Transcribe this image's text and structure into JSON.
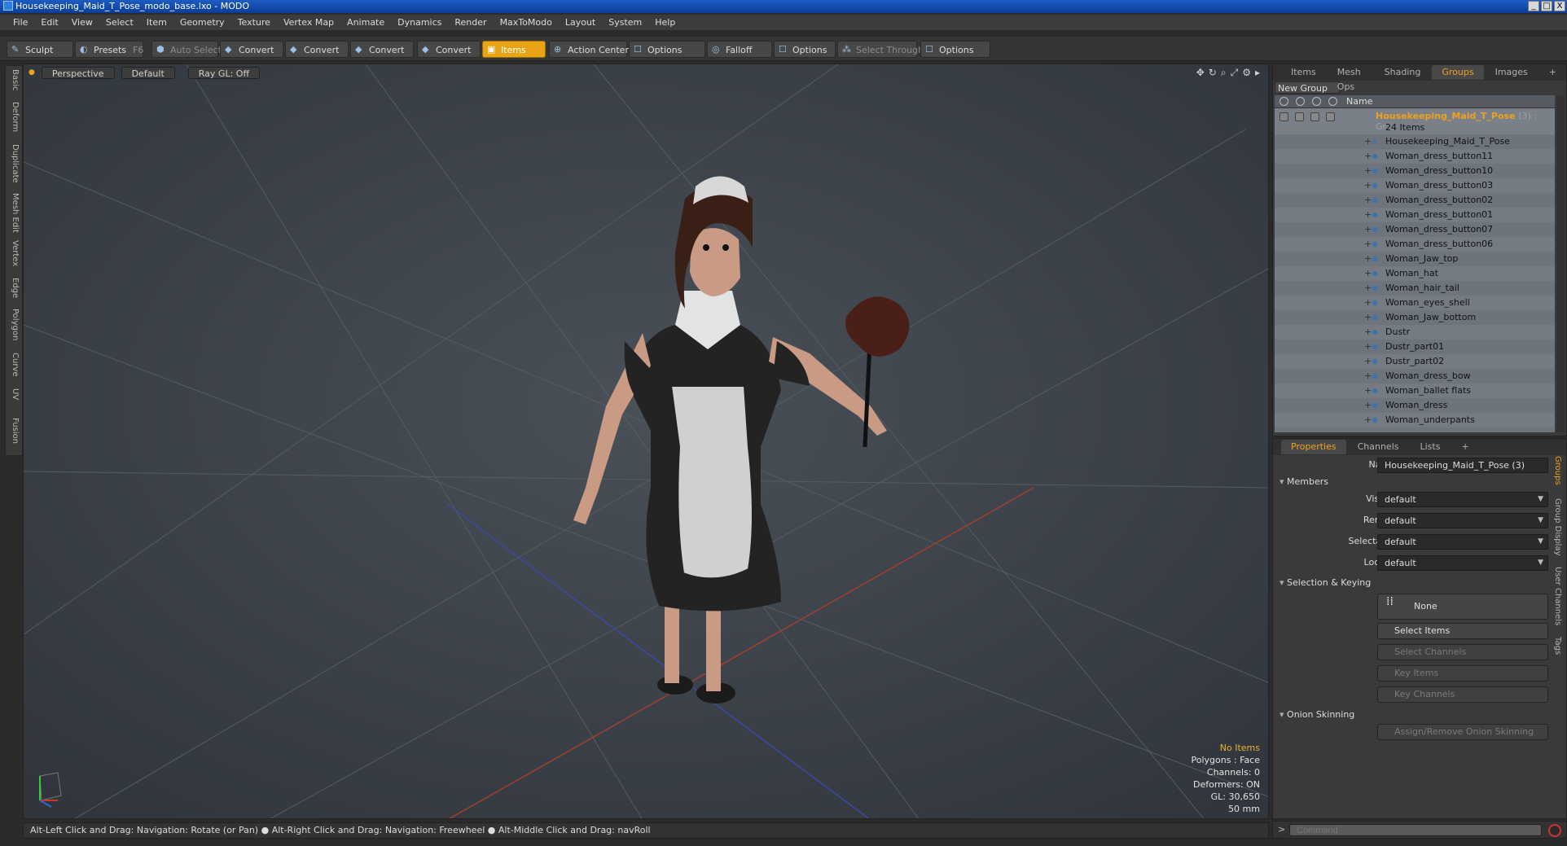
{
  "window": {
    "title": "Housekeeping_Maid_T_Pose_modo_base.lxo - MODO",
    "buttons": [
      "_",
      "□",
      "X"
    ]
  },
  "menu": [
    "File",
    "Edit",
    "View",
    "Select",
    "Item",
    "Geometry",
    "Texture",
    "Vertex Map",
    "Animate",
    "Dynamics",
    "Render",
    "MaxToModo",
    "Layout",
    "System",
    "Help"
  ],
  "toolbar": {
    "sculpt": "Sculpt",
    "presets": "Presets",
    "presets_key": "F6",
    "auto_select": "Auto Select",
    "convert1": "Convert",
    "convert2": "Convert",
    "convert3": "Convert",
    "convert4": "Convert",
    "items": "Items",
    "action_center": "Action Center",
    "options1": "Options",
    "falloff": "Falloff",
    "options2": "Options",
    "select_through": "Select Through",
    "options3": "Options"
  },
  "left_tabs": [
    "Basic",
    "Deform",
    "Duplicate",
    "Mesh Edit",
    "Vertex",
    "Edge",
    "Polygon",
    "Curve",
    "UV",
    "Fusion"
  ],
  "viewport": {
    "view": "Perspective",
    "shading": "Default",
    "raygl": "Ray GL: Off",
    "info": {
      "no_items": "No Items",
      "polygons": "Polygons : Face",
      "channels": "Channels: 0",
      "deformers": "Deformers: ON",
      "gl": "GL: 30,650",
      "size": "50 mm"
    }
  },
  "status": "Alt-Left Click and Drag: Navigation: Rotate (or Pan) ● Alt-Right Click and Drag: Navigation: Freewheel ● Alt-Middle Click and Drag: navRoll",
  "items_panel": {
    "tabs": [
      "Items",
      "Mesh Ops",
      "Shading",
      "Groups",
      "Images",
      "+"
    ],
    "active_tab": "Groups",
    "new_group": "New Group",
    "col_name": "Name",
    "group_name": "Housekeeping_Maid_T_Pose",
    "group_tail": "(3) : Gr...",
    "group_count": "24 Items",
    "rows": [
      "Housekeeping_Maid_T_Pose",
      "Woman_dress_button11",
      "Woman_dress_button10",
      "Woman_dress_button03",
      "Woman_dress_button02",
      "Woman_dress_button01",
      "Woman_dress_button07",
      "Woman_dress_button06",
      "Woman_Jaw_top",
      "Woman_hat",
      "Woman_hair_tail",
      "Woman_eyes_shell",
      "Woman_Jaw_bottom",
      "Dustr",
      "Dustr_part01",
      "Dustr_part02",
      "Woman_dress_bow",
      "Woman_ballet flats",
      "Woman_dress",
      "Woman_underpants"
    ]
  },
  "props_panel": {
    "tabs": [
      "Properties",
      "Channels",
      "Lists",
      "+"
    ],
    "name_label": "Name",
    "name_value": "Housekeeping_Maid_T_Pose (3)",
    "members": "Members",
    "visible_label": "Visible",
    "visible": "default",
    "render_label": "Render",
    "render": "default",
    "selectable_label": "Selectable",
    "selectable": "default",
    "locked_label": "Locked",
    "locked": "default",
    "selection_keying": "Selection & Keying",
    "none": "None",
    "select_items": "Select Items",
    "select_channels": "Select Channels",
    "key_items": "Key Items",
    "key_channels": "Key Channels",
    "onion": "Onion Skinning",
    "assign_onion": "Assign/Remove Onion Skinning",
    "side_tabs": [
      "Groups",
      "Group Display",
      "User Channels",
      "Tags"
    ]
  },
  "command": {
    "placeholder": "Command"
  },
  "colors": {
    "accent": "#f0a020",
    "viewport_bg": "#3a4048",
    "title_blue": "#1d5cc2"
  }
}
